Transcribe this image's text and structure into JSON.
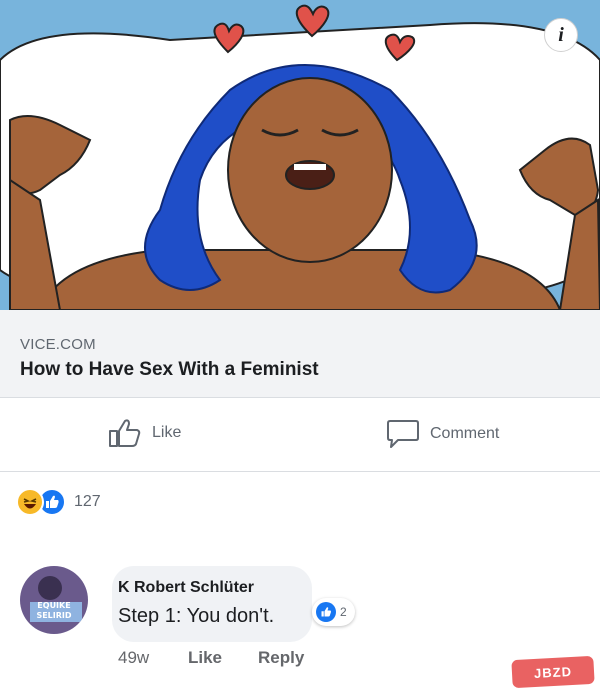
{
  "link_preview": {
    "domain": "VICE.COM",
    "title": "How to Have Sex With a Feminist",
    "info_icon_glyph": "i"
  },
  "actions": {
    "like_label": "Like",
    "comment_label": "Comment"
  },
  "reactions": {
    "icons": [
      "haha-icon",
      "like-icon"
    ],
    "count": "127"
  },
  "comment": {
    "author": "K Robert Schlüter",
    "text": "Step 1: You don't.",
    "reaction_count": "2",
    "time": "49w",
    "like_label": "Like",
    "reply_label": "Reply",
    "avatar_text": "EQUIKE SELIRID"
  },
  "watermark": "JBZD",
  "colors": {
    "background_sky": "#78b4dc",
    "hair": "#1f4ec8",
    "skin": "#a5643a",
    "heart": "#e0524a",
    "facebook_blue": "#1877f2",
    "caption_bg": "#f2f3f5",
    "bubble_bg": "#f0f2f5"
  }
}
